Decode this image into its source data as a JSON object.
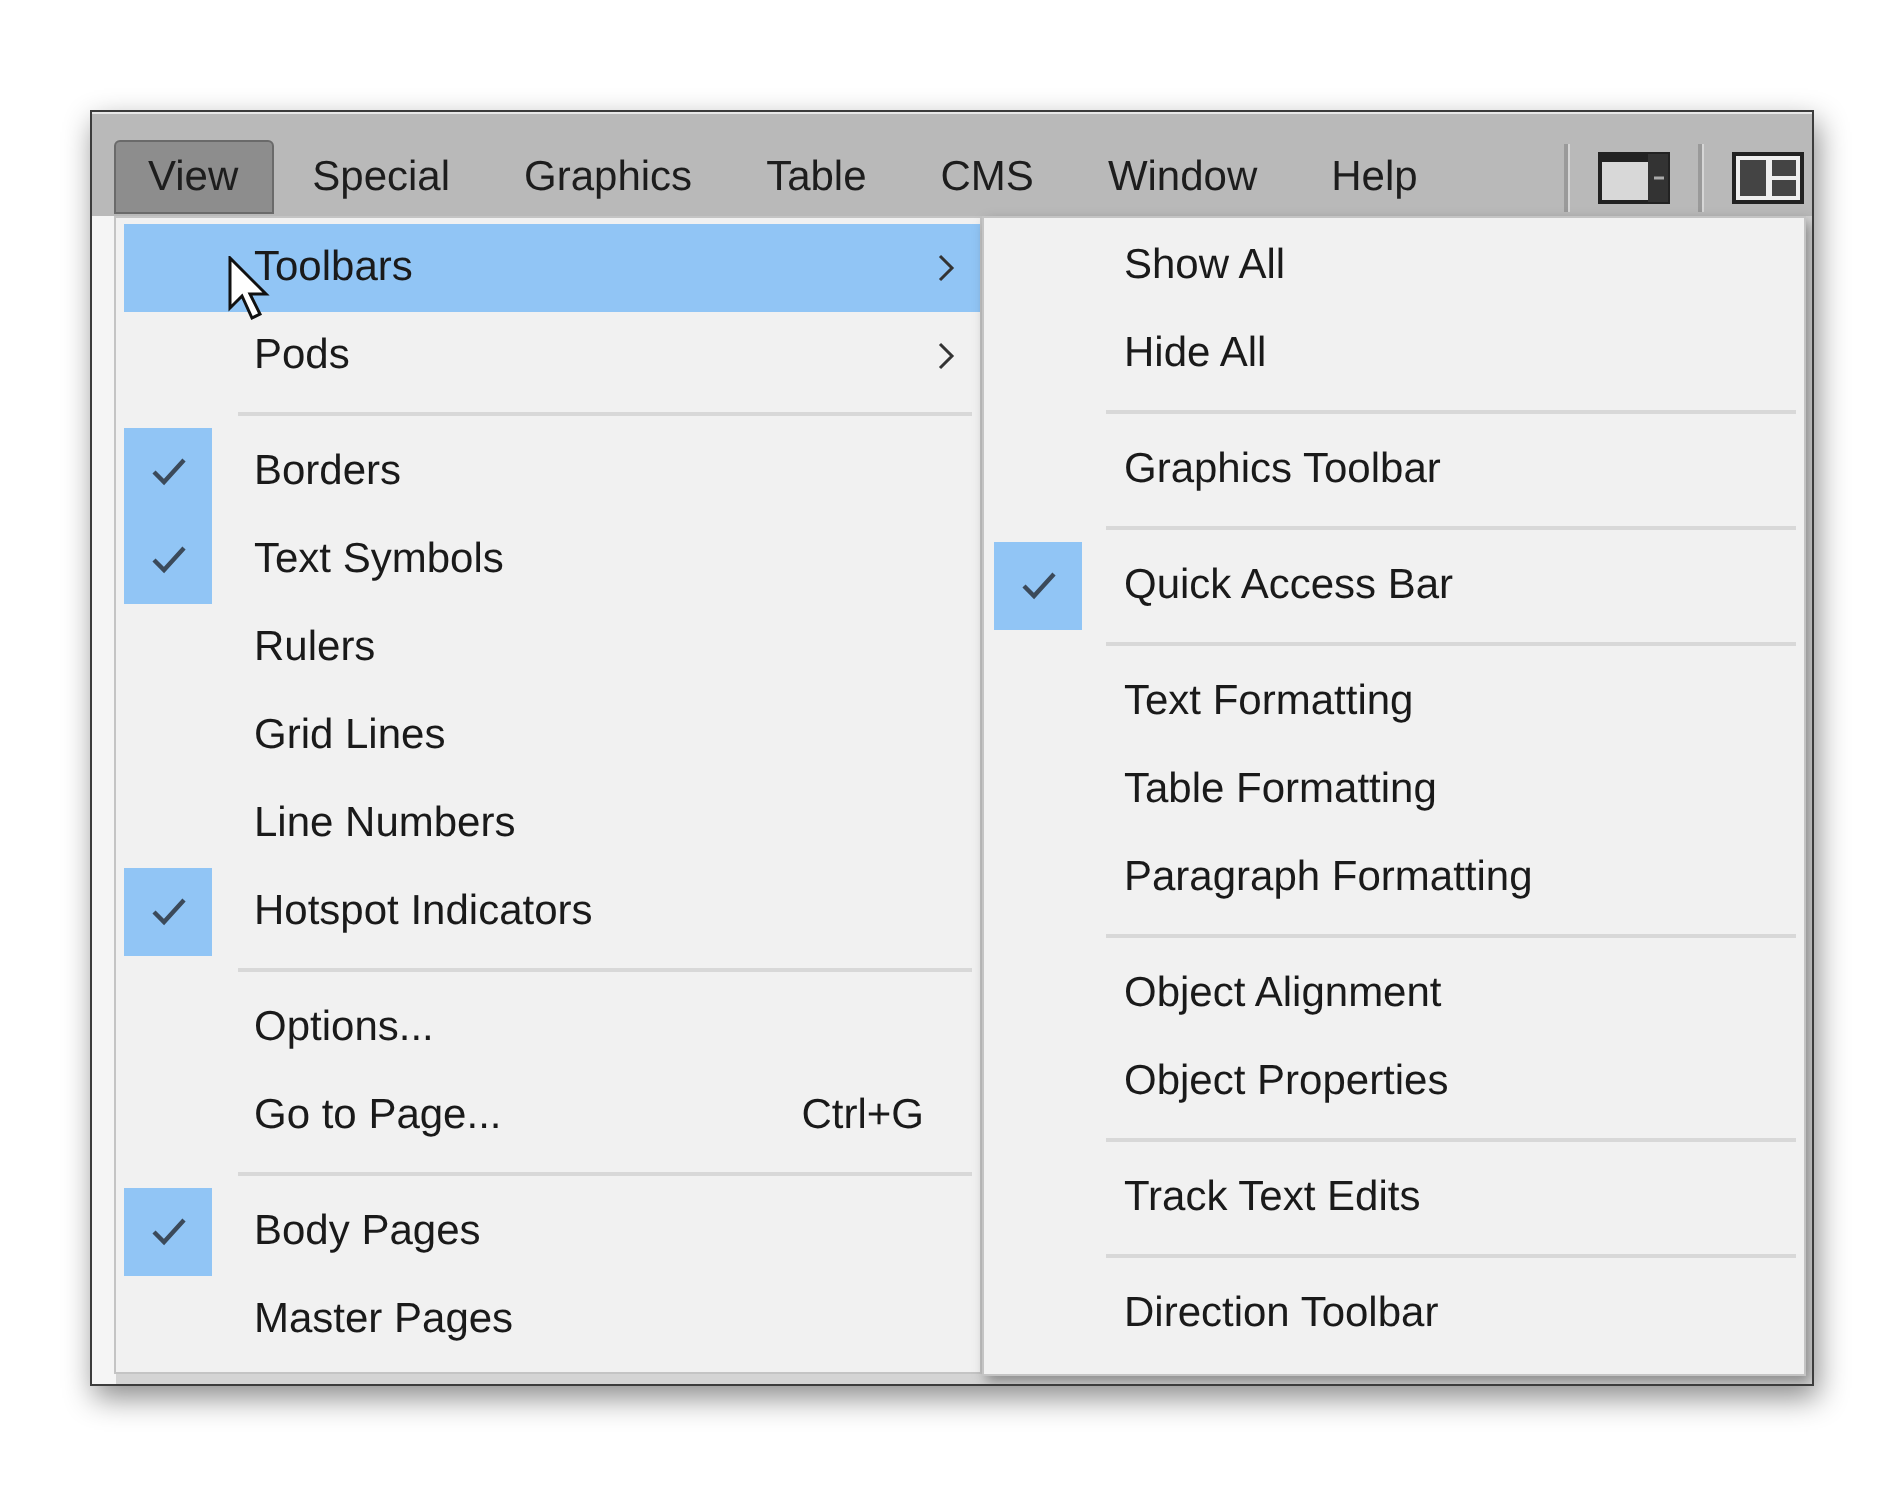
{
  "menubar": {
    "items": [
      {
        "label": "View",
        "selected": true
      },
      {
        "label": "Special",
        "selected": false
      },
      {
        "label": "Graphics",
        "selected": false
      },
      {
        "label": "Table",
        "selected": false
      },
      {
        "label": "CMS",
        "selected": false
      },
      {
        "label": "Window",
        "selected": false
      },
      {
        "label": "Help",
        "selected": false
      }
    ]
  },
  "view_menu": {
    "groups": [
      [
        {
          "kind": "submenu",
          "label": "Toolbars",
          "checked": false,
          "highlighted": true
        },
        {
          "kind": "submenu",
          "label": "Pods",
          "checked": false,
          "highlighted": false
        }
      ],
      [
        {
          "kind": "command",
          "label": "Borders",
          "checked": true,
          "highlighted": false
        },
        {
          "kind": "command",
          "label": "Text Symbols",
          "checked": true,
          "highlighted": false
        },
        {
          "kind": "command",
          "label": "Rulers",
          "checked": false,
          "highlighted": false
        },
        {
          "kind": "command",
          "label": "Grid Lines",
          "checked": false,
          "highlighted": false
        },
        {
          "kind": "command",
          "label": "Line Numbers",
          "checked": false,
          "highlighted": false
        },
        {
          "kind": "command",
          "label": "Hotspot Indicators",
          "checked": true,
          "highlighted": false
        }
      ],
      [
        {
          "kind": "command",
          "label": "Options...",
          "checked": false,
          "highlighted": false
        },
        {
          "kind": "command",
          "label": "Go to Page...",
          "shortcut": "Ctrl+G",
          "checked": false,
          "highlighted": false
        }
      ],
      [
        {
          "kind": "command",
          "label": "Body Pages",
          "checked": true,
          "highlighted": false
        },
        {
          "kind": "command",
          "label": "Master Pages",
          "checked": false,
          "highlighted": false
        }
      ]
    ]
  },
  "toolbars_submenu": {
    "groups": [
      [
        {
          "label": "Show All",
          "checked": false
        },
        {
          "label": "Hide All",
          "checked": false
        }
      ],
      [
        {
          "label": "Graphics Toolbar",
          "checked": false
        }
      ],
      [
        {
          "label": "Quick Access Bar",
          "checked": true
        }
      ],
      [
        {
          "label": "Text Formatting",
          "checked": false
        },
        {
          "label": "Table Formatting",
          "checked": false
        },
        {
          "label": "Paragraph Formatting",
          "checked": false
        }
      ],
      [
        {
          "label": "Object Alignment",
          "checked": false
        },
        {
          "label": "Object Properties",
          "checked": false
        }
      ],
      [
        {
          "label": "Track Text Edits",
          "checked": false
        }
      ],
      [
        {
          "label": "Direction Toolbar",
          "checked": false
        }
      ]
    ]
  }
}
